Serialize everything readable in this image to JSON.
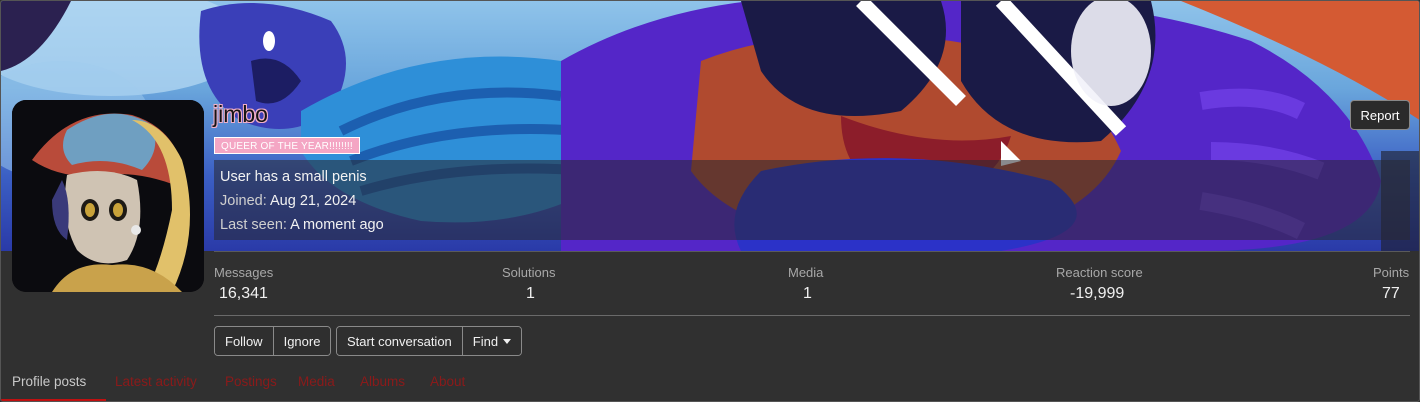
{
  "profile": {
    "username": "jimbo",
    "banner_title": "QUEER OF THE YEAR!!!!!!!!",
    "bio": "User has a small penis",
    "joined_label": "Joined:",
    "joined_value": "Aug 21, 2024",
    "last_seen_label": "Last seen:",
    "last_seen_value": "A moment ago",
    "report_label": "Report"
  },
  "stats": [
    {
      "label": "Messages",
      "value": "16,341"
    },
    {
      "label": "Solutions",
      "value": "1"
    },
    {
      "label": "Media",
      "value": "1"
    },
    {
      "label": "Reaction score",
      "value": "-19,999"
    },
    {
      "label": "Points",
      "value": "77"
    }
  ],
  "actions": {
    "follow": "Follow",
    "ignore": "Ignore",
    "start_conversation": "Start conversation",
    "find": "Find"
  },
  "tabs": [
    {
      "label": "Profile posts",
      "active": true
    },
    {
      "label": "Latest activity",
      "active": false
    },
    {
      "label": "Postings",
      "active": false
    },
    {
      "label": "Media",
      "active": false
    },
    {
      "label": "Albums",
      "active": false
    },
    {
      "label": "About",
      "active": false
    }
  ],
  "colors": {
    "page_bg": "#2f2f2f",
    "tab_accent": "#c01010",
    "badge_bg": "#f4a6c4"
  }
}
